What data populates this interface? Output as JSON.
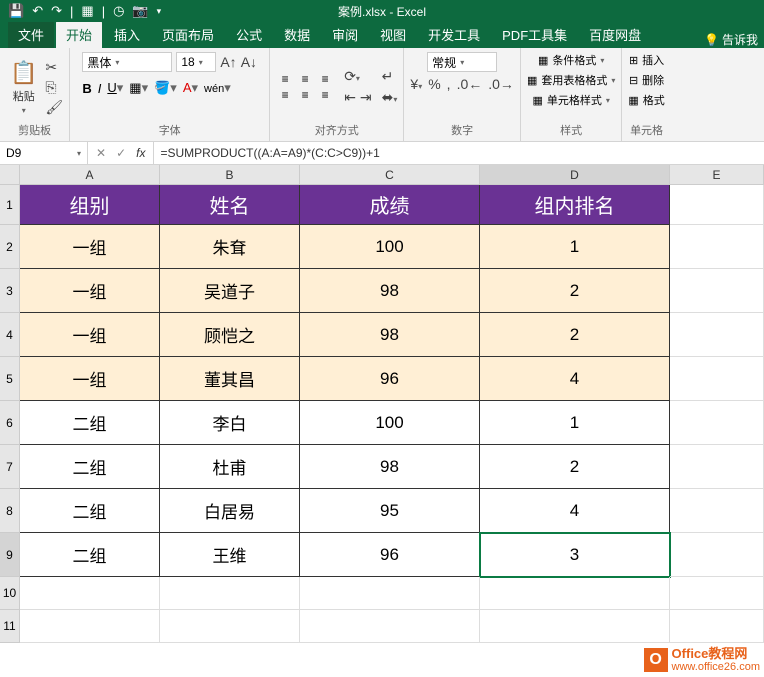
{
  "titlebar": {
    "title": "案例.xlsx - Excel"
  },
  "tabs": {
    "file": "文件",
    "home": "开始",
    "insert": "插入",
    "pagelayout": "页面布局",
    "formulas": "公式",
    "data": "数据",
    "review": "审阅",
    "view": "视图",
    "developer": "开发工具",
    "pdftools": "PDF工具集",
    "baidudisk": "百度网盘",
    "tellme": "告诉我"
  },
  "ribbon": {
    "clipboard": {
      "paste": "粘贴",
      "label": "剪贴板"
    },
    "font": {
      "name": "黑体",
      "size": "18",
      "label": "字体"
    },
    "align": {
      "label": "对齐方式"
    },
    "number": {
      "format": "常规",
      "label": "数字"
    },
    "styles": {
      "cond": "条件格式",
      "tbl": "套用表格格式",
      "cell": "单元格样式",
      "label": "样式"
    },
    "cells": {
      "insert": "插入",
      "delete": "删除",
      "format": "格式",
      "label": "单元格"
    }
  },
  "formula": {
    "cell": "D9",
    "value": "=SUMPRODUCT((A:A=A9)*(C:C>C9))+1"
  },
  "columns": [
    "A",
    "B",
    "C",
    "D",
    "E"
  ],
  "headers": [
    "组别",
    "姓名",
    "成绩",
    "组内排名"
  ],
  "rows": [
    {
      "g": "一组",
      "n": "朱耷",
      "s": "100",
      "r": "1",
      "cls": "g1"
    },
    {
      "g": "一组",
      "n": "吴道子",
      "s": "98",
      "r": "2",
      "cls": "g1"
    },
    {
      "g": "一组",
      "n": "顾恺之",
      "s": "98",
      "r": "2",
      "cls": "g1"
    },
    {
      "g": "一组",
      "n": "董其昌",
      "s": "96",
      "r": "4",
      "cls": "g1"
    },
    {
      "g": "二组",
      "n": "李白",
      "s": "100",
      "r": "1",
      "cls": "g2"
    },
    {
      "g": "二组",
      "n": "杜甫",
      "s": "98",
      "r": "2",
      "cls": "g2"
    },
    {
      "g": "二组",
      "n": "白居易",
      "s": "95",
      "r": "4",
      "cls": "g2"
    },
    {
      "g": "二组",
      "n": "王维",
      "s": "96",
      "r": "3",
      "cls": "g2"
    }
  ],
  "watermark": {
    "line1": "Office教程网",
    "line2": "www.office26.com",
    "o": "O"
  }
}
